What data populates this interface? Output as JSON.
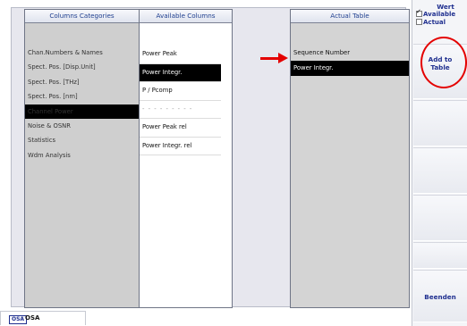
{
  "columns_categories": {
    "header": "Columns Categories",
    "items": [
      {
        "label": "Chan.Numbers & Names",
        "selected": false
      },
      {
        "label": "Spect. Pos. [Disp.Unit]",
        "selected": false
      },
      {
        "label": "Spect. Pos. [THz]",
        "selected": false
      },
      {
        "label": "Spect. Pos. [nm]",
        "selected": false
      },
      {
        "label": "Channel Power",
        "selected": true
      },
      {
        "label": "Noise & OSNR",
        "selected": false
      },
      {
        "label": "Statistics",
        "selected": false
      },
      {
        "label": "Wdm Analysis",
        "selected": false
      }
    ]
  },
  "available_columns": {
    "header": "Available Columns",
    "items": [
      {
        "label": "Power Peak",
        "selected": false
      },
      {
        "label": "Power Integr.",
        "selected": true
      },
      {
        "label": "P / Pcomp",
        "selected": false
      },
      {
        "label": "- - - - - - - - -",
        "selected": false
      },
      {
        "label": "Power Peak rel",
        "selected": false
      },
      {
        "label": "Power Integr. rel",
        "selected": false
      }
    ]
  },
  "actual_table": {
    "header": "Actual Table",
    "items": [
      {
        "label": "Sequence Number",
        "selected": false
      },
      {
        "label": "Power Integr.",
        "selected": true
      }
    ]
  },
  "sidebar": {
    "wert_title": "Wert",
    "available_label": "Available",
    "available_checked": true,
    "actual_label": "Actual",
    "actual_checked": false,
    "add_line1": "Add to",
    "add_line2": "Table",
    "exit_label": "Beenden"
  },
  "status_tab": {
    "badge": "OSA",
    "label": "OSA"
  },
  "colors": {
    "highlight": "#e40000",
    "selection": "#000000",
    "accent": "#1f2f8f"
  }
}
